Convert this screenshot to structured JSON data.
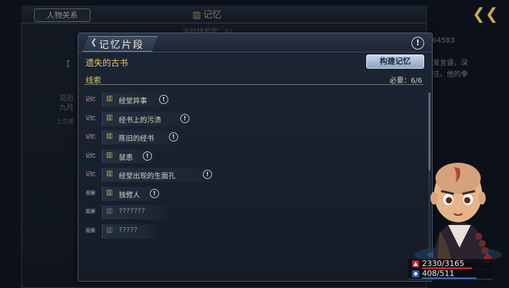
{
  "background": {
    "tab_label": "人物关系",
    "title": "记忆",
    "subtitle": "当前线索度：6/",
    "right_number": "/64583",
    "right_text1": "爱言语，深",
    "right_text2": "往。他的拳",
    "left_text1": "见历",
    "left_text2": "九月",
    "left_text3": "上京城",
    "bracket": "【"
  },
  "modal": {
    "title": "记忆片段",
    "memory_name": "遗失的古书",
    "build_button": "构建记忆",
    "clues_label": "线索",
    "required_label": "必要：6/6"
  },
  "clues": [
    {
      "tag": "记忆",
      "text": "经堂异事",
      "locked": false,
      "icon": "book-icon"
    },
    {
      "tag": "记忆",
      "text": "经书上的污渍",
      "locked": false,
      "icon": "book-icon"
    },
    {
      "tag": "记忆",
      "text": "陈旧的经书",
      "locked": false,
      "icon": "book-icon"
    },
    {
      "tag": "记忆",
      "text": "鼠患",
      "locked": false,
      "icon": "book-icon"
    },
    {
      "tag": "记忆",
      "text": "经堂出现的生面孔",
      "locked": false,
      "icon": "book-icon"
    },
    {
      "tag": "观察",
      "text": "独臂人",
      "locked": false,
      "icon": "book-icon"
    },
    {
      "tag": "观察",
      "text": "???????",
      "locked": true,
      "icon": "book-icon"
    },
    {
      "tag": "观察",
      "text": "?????",
      "locked": true,
      "icon": "book-icon"
    }
  ],
  "character": {
    "hp": "2330/3165",
    "hp_fraction": 0.736,
    "mp": "408/511",
    "mp_fraction": 0.798
  },
  "colors": {
    "accent_gold": "#e0c56a",
    "memory_tag": "#d6a2cf",
    "hp": "#cc3333",
    "mp": "#3366cc"
  }
}
